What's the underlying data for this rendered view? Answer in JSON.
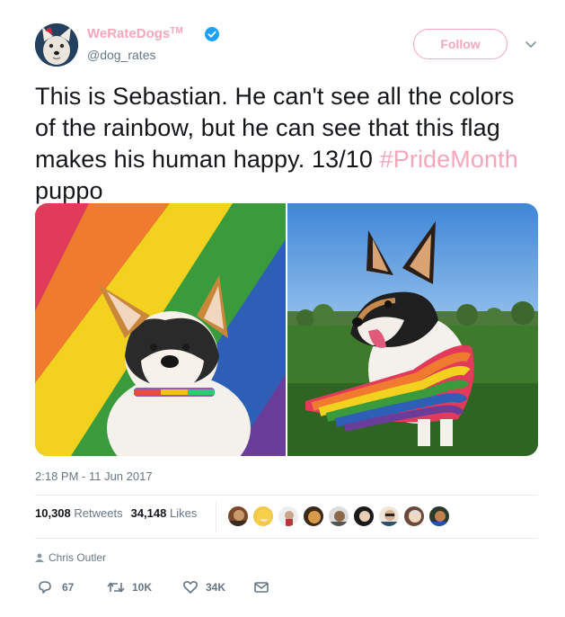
{
  "user": {
    "display_name": "WeRateDogs",
    "trademark": "TM",
    "handle": "@dog_rates",
    "verified": true
  },
  "header": {
    "follow_label": "Follow"
  },
  "tweet": {
    "text_main": "This is Sebastian. He can't see all the colors of the rainbow, but he can see that this flag makes his human happy. 13/10 ",
    "hashtag": "#PrideMonth",
    "text_end": "puppo",
    "timestamp": "2:18 PM - 11 Jun 2017"
  },
  "stats": {
    "retweets_count": "10,308",
    "retweets_label": "Retweets",
    "likes_count": "34,148",
    "likes_label": "Likes"
  },
  "author_line": "Chris Outler",
  "actions": {
    "reply_count": "67",
    "retweet_count": "10K",
    "like_count": "34K"
  },
  "colors": {
    "accent": "#f4a7b9",
    "secondary_text": "#657786",
    "verified_blue": "#1da1f2"
  },
  "icons": [
    "verified-badge-icon",
    "chevron-down-icon",
    "person-icon",
    "reply-icon",
    "retweet-icon",
    "heart-icon",
    "envelope-icon"
  ]
}
